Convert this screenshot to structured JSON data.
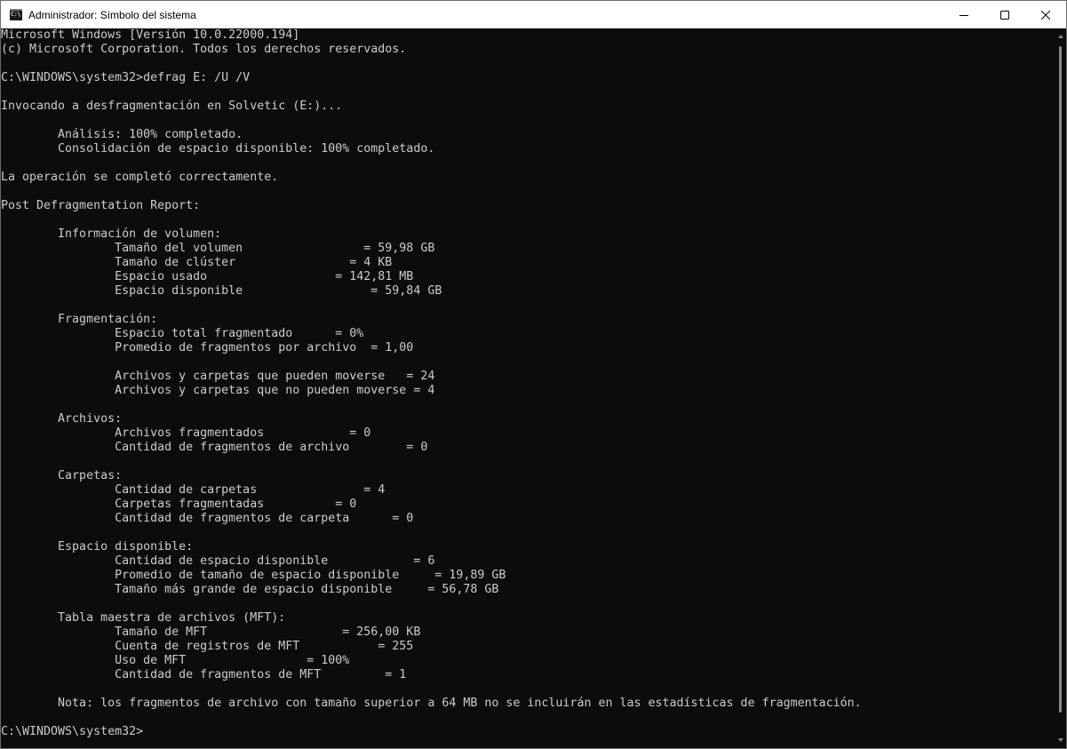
{
  "window": {
    "title": "Administrador: Símbolo del sistema",
    "icon_label": "C:\\",
    "controls": {
      "minimize_icon": "minimize-icon",
      "maximize_icon": "maximize-icon",
      "close_icon": "close-icon"
    }
  },
  "console": {
    "background": "#0c0c0c",
    "foreground": "#cccccc",
    "lines": [
      "Microsoft Windows [Versión 10.0.22000.194]",
      "(c) Microsoft Corporation. Todos los derechos reservados.",
      "",
      "C:\\WINDOWS\\system32>defrag E: /U /V",
      "",
      "Invocando a desfragmentación en Solvetic (E:)...",
      "",
      "        Análisis: 100% completado.",
      "        Consolidación de espacio disponible: 100% completado.",
      "",
      "La operación se completó correctamente.",
      "",
      "Post Defragmentation Report:",
      "",
      "        Información de volumen:",
      "                Tamaño del volumen                 = 59,98 GB",
      "                Tamaño de clúster                = 4 KB",
      "                Espacio usado                  = 142,81 MB",
      "                Espacio disponible                  = 59,84 GB",
      "",
      "        Fragmentación:",
      "                Espacio total fragmentado      = 0%",
      "                Promedio de fragmentos por archivo  = 1,00",
      "",
      "                Archivos y carpetas que pueden moverse   = 24",
      "                Archivos y carpetas que no pueden moverse = 4",
      "",
      "        Archivos:",
      "                Archivos fragmentados            = 0",
      "                Cantidad de fragmentos de archivo        = 0",
      "",
      "        Carpetas:",
      "                Cantidad de carpetas               = 4",
      "                Carpetas fragmentadas          = 0",
      "                Cantidad de fragmentos de carpeta      = 0",
      "",
      "        Espacio disponible:",
      "                Cantidad de espacio disponible            = 6",
      "                Promedio de tamaño de espacio disponible     = 19,89 GB",
      "                Tamaño más grande de espacio disponible     = 56,78 GB",
      "",
      "        Tabla maestra de archivos (MFT):",
      "                Tamaño de MFT                   = 256,00 KB",
      "                Cuenta de registros de MFT           = 255",
      "                Uso de MFT                 = 100%",
      "                Cantidad de fragmentos de MFT         = 1",
      "",
      "        Nota: los fragmentos de archivo con tamaño superior a 64 MB no se incluirán en las estadísticas de fragmentación.",
      "",
      "C:\\WINDOWS\\system32>"
    ]
  }
}
